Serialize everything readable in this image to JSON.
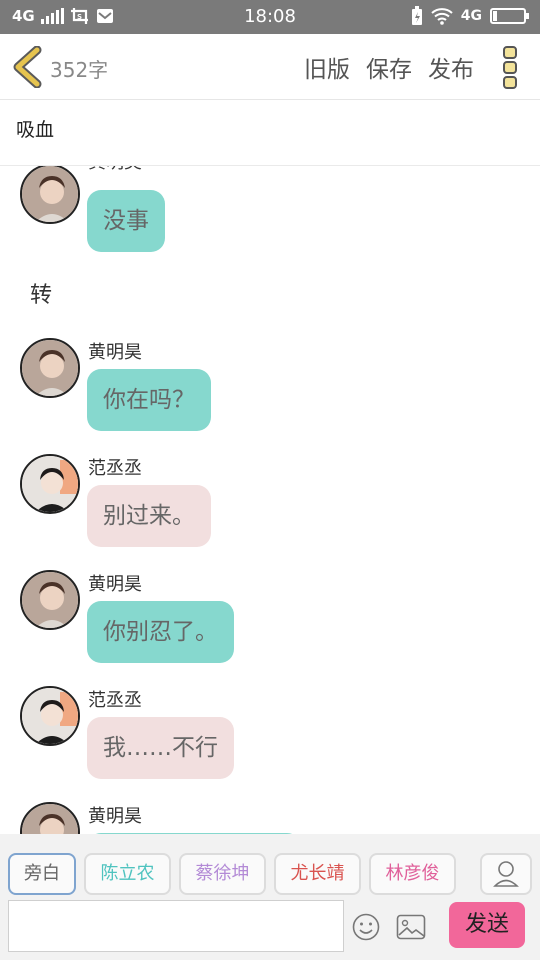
{
  "status_bar": {
    "network": "4G",
    "network2": "4G",
    "time": "18:08"
  },
  "header": {
    "word_count": "352字",
    "old_version": "旧版",
    "save": "保存",
    "publish": "发布"
  },
  "title": "吸血",
  "messages": [
    {
      "type": "char",
      "name": "黄明昊",
      "text": "没事",
      "color": "green"
    },
    {
      "type": "narration",
      "text": "转"
    },
    {
      "type": "char",
      "name": "黄明昊",
      "text": "你在吗？",
      "color": "green"
    },
    {
      "type": "char",
      "name": "范丞丞",
      "text": "别过来。",
      "color": "pink"
    },
    {
      "type": "char",
      "name": "黄明昊",
      "text": "你别忍了。",
      "color": "green"
    },
    {
      "type": "char",
      "name": "范丞丞",
      "text": "我……不行",
      "color": "pink"
    },
    {
      "type": "char",
      "name": "黄明昊",
      "text": "",
      "color": "green"
    }
  ],
  "characters": [
    {
      "label": "旁白",
      "color": "#666666"
    },
    {
      "label": "陈立农",
      "color": "#4fc3bf"
    },
    {
      "label": "蔡徐坤",
      "color": "#b38ad6"
    },
    {
      "label": "尤长靖",
      "color": "#d9534f"
    },
    {
      "label": "林彦俊",
      "color": "#e0609a"
    }
  ],
  "input": {
    "placeholder": ""
  },
  "send_label": "发送",
  "colors": {
    "bubble_green": "#86d8ce",
    "bubble_pink": "#f2dfdf",
    "send": "#f2679a",
    "accent": "#e3c14a"
  }
}
